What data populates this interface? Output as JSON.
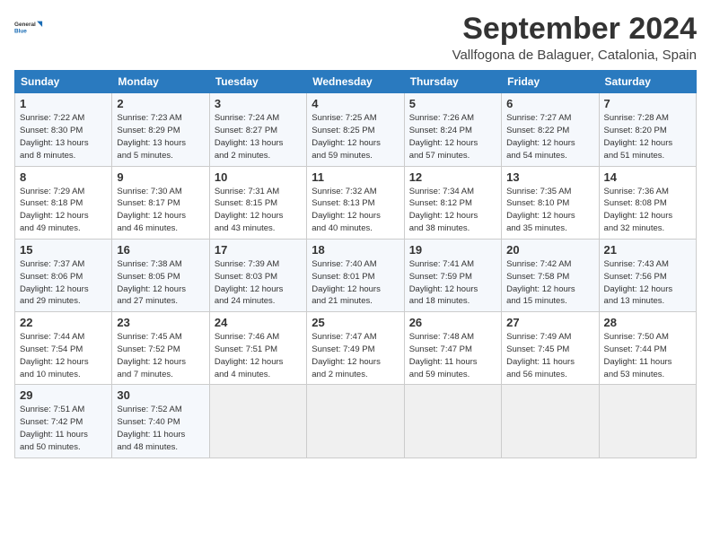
{
  "logo": {
    "line1": "General",
    "line2": "Blue"
  },
  "title": "September 2024",
  "location": "Vallfogona de Balaguer, Catalonia, Spain",
  "headers": [
    "Sunday",
    "Monday",
    "Tuesday",
    "Wednesday",
    "Thursday",
    "Friday",
    "Saturday"
  ],
  "weeks": [
    [
      {
        "day": "1",
        "detail": "Sunrise: 7:22 AM\nSunset: 8:30 PM\nDaylight: 13 hours\nand 8 minutes."
      },
      {
        "day": "2",
        "detail": "Sunrise: 7:23 AM\nSunset: 8:29 PM\nDaylight: 13 hours\nand 5 minutes."
      },
      {
        "day": "3",
        "detail": "Sunrise: 7:24 AM\nSunset: 8:27 PM\nDaylight: 13 hours\nand 2 minutes."
      },
      {
        "day": "4",
        "detail": "Sunrise: 7:25 AM\nSunset: 8:25 PM\nDaylight: 12 hours\nand 59 minutes."
      },
      {
        "day": "5",
        "detail": "Sunrise: 7:26 AM\nSunset: 8:24 PM\nDaylight: 12 hours\nand 57 minutes."
      },
      {
        "day": "6",
        "detail": "Sunrise: 7:27 AM\nSunset: 8:22 PM\nDaylight: 12 hours\nand 54 minutes."
      },
      {
        "day": "7",
        "detail": "Sunrise: 7:28 AM\nSunset: 8:20 PM\nDaylight: 12 hours\nand 51 minutes."
      }
    ],
    [
      {
        "day": "8",
        "detail": "Sunrise: 7:29 AM\nSunset: 8:18 PM\nDaylight: 12 hours\nand 49 minutes."
      },
      {
        "day": "9",
        "detail": "Sunrise: 7:30 AM\nSunset: 8:17 PM\nDaylight: 12 hours\nand 46 minutes."
      },
      {
        "day": "10",
        "detail": "Sunrise: 7:31 AM\nSunset: 8:15 PM\nDaylight: 12 hours\nand 43 minutes."
      },
      {
        "day": "11",
        "detail": "Sunrise: 7:32 AM\nSunset: 8:13 PM\nDaylight: 12 hours\nand 40 minutes."
      },
      {
        "day": "12",
        "detail": "Sunrise: 7:34 AM\nSunset: 8:12 PM\nDaylight: 12 hours\nand 38 minutes."
      },
      {
        "day": "13",
        "detail": "Sunrise: 7:35 AM\nSunset: 8:10 PM\nDaylight: 12 hours\nand 35 minutes."
      },
      {
        "day": "14",
        "detail": "Sunrise: 7:36 AM\nSunset: 8:08 PM\nDaylight: 12 hours\nand 32 minutes."
      }
    ],
    [
      {
        "day": "15",
        "detail": "Sunrise: 7:37 AM\nSunset: 8:06 PM\nDaylight: 12 hours\nand 29 minutes."
      },
      {
        "day": "16",
        "detail": "Sunrise: 7:38 AM\nSunset: 8:05 PM\nDaylight: 12 hours\nand 27 minutes."
      },
      {
        "day": "17",
        "detail": "Sunrise: 7:39 AM\nSunset: 8:03 PM\nDaylight: 12 hours\nand 24 minutes."
      },
      {
        "day": "18",
        "detail": "Sunrise: 7:40 AM\nSunset: 8:01 PM\nDaylight: 12 hours\nand 21 minutes."
      },
      {
        "day": "19",
        "detail": "Sunrise: 7:41 AM\nSunset: 7:59 PM\nDaylight: 12 hours\nand 18 minutes."
      },
      {
        "day": "20",
        "detail": "Sunrise: 7:42 AM\nSunset: 7:58 PM\nDaylight: 12 hours\nand 15 minutes."
      },
      {
        "day": "21",
        "detail": "Sunrise: 7:43 AM\nSunset: 7:56 PM\nDaylight: 12 hours\nand 13 minutes."
      }
    ],
    [
      {
        "day": "22",
        "detail": "Sunrise: 7:44 AM\nSunset: 7:54 PM\nDaylight: 12 hours\nand 10 minutes."
      },
      {
        "day": "23",
        "detail": "Sunrise: 7:45 AM\nSunset: 7:52 PM\nDaylight: 12 hours\nand 7 minutes."
      },
      {
        "day": "24",
        "detail": "Sunrise: 7:46 AM\nSunset: 7:51 PM\nDaylight: 12 hours\nand 4 minutes."
      },
      {
        "day": "25",
        "detail": "Sunrise: 7:47 AM\nSunset: 7:49 PM\nDaylight: 12 hours\nand 2 minutes."
      },
      {
        "day": "26",
        "detail": "Sunrise: 7:48 AM\nSunset: 7:47 PM\nDaylight: 11 hours\nand 59 minutes."
      },
      {
        "day": "27",
        "detail": "Sunrise: 7:49 AM\nSunset: 7:45 PM\nDaylight: 11 hours\nand 56 minutes."
      },
      {
        "day": "28",
        "detail": "Sunrise: 7:50 AM\nSunset: 7:44 PM\nDaylight: 11 hours\nand 53 minutes."
      }
    ],
    [
      {
        "day": "29",
        "detail": "Sunrise: 7:51 AM\nSunset: 7:42 PM\nDaylight: 11 hours\nand 50 minutes."
      },
      {
        "day": "30",
        "detail": "Sunrise: 7:52 AM\nSunset: 7:40 PM\nDaylight: 11 hours\nand 48 minutes."
      },
      {
        "day": "",
        "detail": ""
      },
      {
        "day": "",
        "detail": ""
      },
      {
        "day": "",
        "detail": ""
      },
      {
        "day": "",
        "detail": ""
      },
      {
        "day": "",
        "detail": ""
      }
    ]
  ]
}
